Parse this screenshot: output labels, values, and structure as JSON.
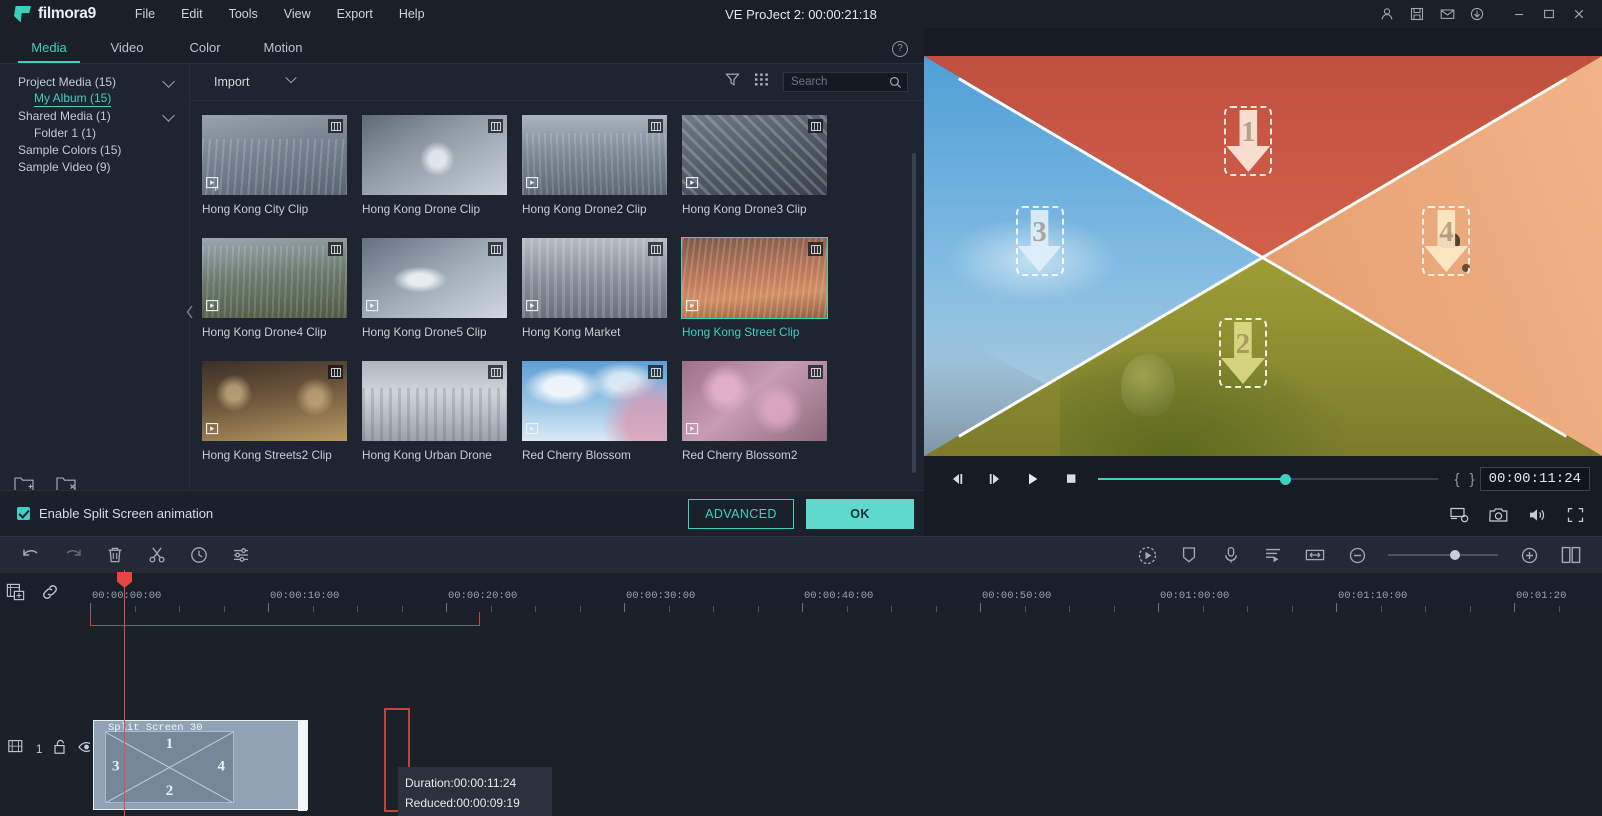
{
  "app": {
    "brand": "filmora9",
    "title": "VE ProJect 2: 00:00:21:18",
    "menus": [
      "File",
      "Edit",
      "Tools",
      "View",
      "Export",
      "Help"
    ],
    "window_icons": [
      "account-icon",
      "save-icon",
      "mail-icon",
      "download-icon",
      "minimize-icon",
      "maximize-icon",
      "close-icon"
    ]
  },
  "panel": {
    "tabs": [
      {
        "label": "Media",
        "active": true
      },
      {
        "label": "Video",
        "active": false
      },
      {
        "label": "Color",
        "active": false
      },
      {
        "label": "Motion",
        "active": false
      }
    ],
    "help_icon": "?"
  },
  "sidebar": {
    "tree": [
      {
        "label": "Project Media (15)",
        "indent": 0,
        "chevron": true,
        "selected": false
      },
      {
        "label": "My Album (15)",
        "indent": 1,
        "chevron": false,
        "selected": true
      },
      {
        "label": "Shared Media (1)",
        "indent": 0,
        "chevron": true,
        "selected": false
      },
      {
        "label": "Folder 1 (1)",
        "indent": 1,
        "chevron": false,
        "selected": false
      },
      {
        "label": "Sample Colors (15)",
        "indent": 0,
        "chevron": false,
        "selected": false
      },
      {
        "label": "Sample Video (9)",
        "indent": 0,
        "chevron": false,
        "selected": false
      }
    ],
    "footer_icons": [
      "new-folder-icon",
      "delete-folder-icon"
    ]
  },
  "toolbar": {
    "import_label": "Import",
    "filter_icon": "filter-icon",
    "viewmode_icon": "grid-view-icon",
    "search_placeholder": "Search",
    "search_value": ""
  },
  "media": {
    "items": [
      {
        "label": "Hong Kong City Clip",
        "selected": false,
        "tone": "#7e8b99,#aab5c0"
      },
      {
        "label": "Hong Kong Drone Clip",
        "selected": false,
        "tone": "#6f7c8a,#c3ccd4"
      },
      {
        "label": "Hong Kong Drone2 Clip",
        "selected": false,
        "tone": "#8e9aa6,#b8c2cb"
      },
      {
        "label": "Hong Kong Drone3 Clip",
        "selected": false,
        "tone": "#5d6a78,#9aa6b2"
      },
      {
        "label": "Hong Kong Drone4 Clip",
        "selected": false,
        "tone": "#6a7a66,#a9b5a2"
      },
      {
        "label": "Hong Kong Drone5 Clip",
        "selected": false,
        "tone": "#7d8b98,#c6d0d8"
      },
      {
        "label": "Hong Kong Market",
        "selected": false,
        "tone": "#8d9099,#c8cbd2"
      },
      {
        "label": "Hong Kong Street Clip",
        "selected": true,
        "tone": "#8a5f4a,#c68f63"
      },
      {
        "label": "Hong Kong Streets2 Clip",
        "selected": false,
        "tone": "#4a3a2e,#b59465"
      },
      {
        "label": "Hong Kong Urban Drone",
        "selected": false,
        "tone": "#8e96a0,#d2d8de"
      },
      {
        "label": "Red Cherry Blossom",
        "selected": false,
        "tone": "#6fa8d8,#cfe2f2"
      },
      {
        "label": "Red Cherry Blossom2",
        "selected": false,
        "tone": "#8d5f7a,#d6b4c8"
      }
    ]
  },
  "actions": {
    "checkbox_label": "Enable Split Screen animation",
    "checkbox_checked": true,
    "advanced_label": "ADVANCED",
    "ok_label": "OK"
  },
  "preview": {
    "split_zones": [
      {
        "number": "1",
        "position": "top"
      },
      {
        "number": "2",
        "position": "bottom"
      },
      {
        "number": "3",
        "position": "left"
      },
      {
        "number": "4",
        "position": "right"
      }
    ],
    "controls": [
      "prev-frame-icon",
      "next-frame-icon",
      "play-icon",
      "stop-icon"
    ],
    "timecode": "00:00:11:24",
    "mark_in": "{",
    "mark_out": "}",
    "progress_percent": 45,
    "bottom_icons": [
      "render-preview-icon",
      "snapshot-icon",
      "volume-icon",
      "fullscreen-icon"
    ]
  },
  "timeline": {
    "left_icons": [
      "undo-icon",
      "redo-icon",
      "delete-icon",
      "split-scissors-icon",
      "speed-clock-icon",
      "adjust-sliders-icon"
    ],
    "right_icons": [
      "render-preview-icon",
      "marker-icon",
      "voiceover-mic-icon",
      "audio-mixer-icon",
      "fit-timeline-icon",
      "zoom-out-icon",
      "zoom-in-icon",
      "split-view-icon"
    ],
    "ruler_icons": [
      "add-media-icon",
      "link-icon"
    ],
    "zoom_percent": 56,
    "ruler_labels": [
      "00:00:00:00",
      "00:00:10:00",
      "00:00:20:00",
      "00:00:30:00",
      "00:00:40:00",
      "00:00:50:00",
      "00:01:00:00",
      "00:01:10:00",
      "00:01:20"
    ],
    "track": {
      "number": "1",
      "lock_icon": "unlock-icon",
      "eye_icon": "visibility-icon"
    },
    "clip": {
      "title": "Split Screen 30",
      "zone_numbers": [
        "1",
        "2",
        "3",
        "4"
      ]
    },
    "tooltip": {
      "duration": "Duration:00:00:11:24",
      "reduced": "Reduced:00:00:09:19"
    }
  },
  "colors": {
    "accent": "#3fd0c0",
    "ok_button": "#5fd9cc",
    "playhead": "#e8453f",
    "panel_bg": "#1e2430",
    "titlebar_bg": "#1a1f28"
  }
}
